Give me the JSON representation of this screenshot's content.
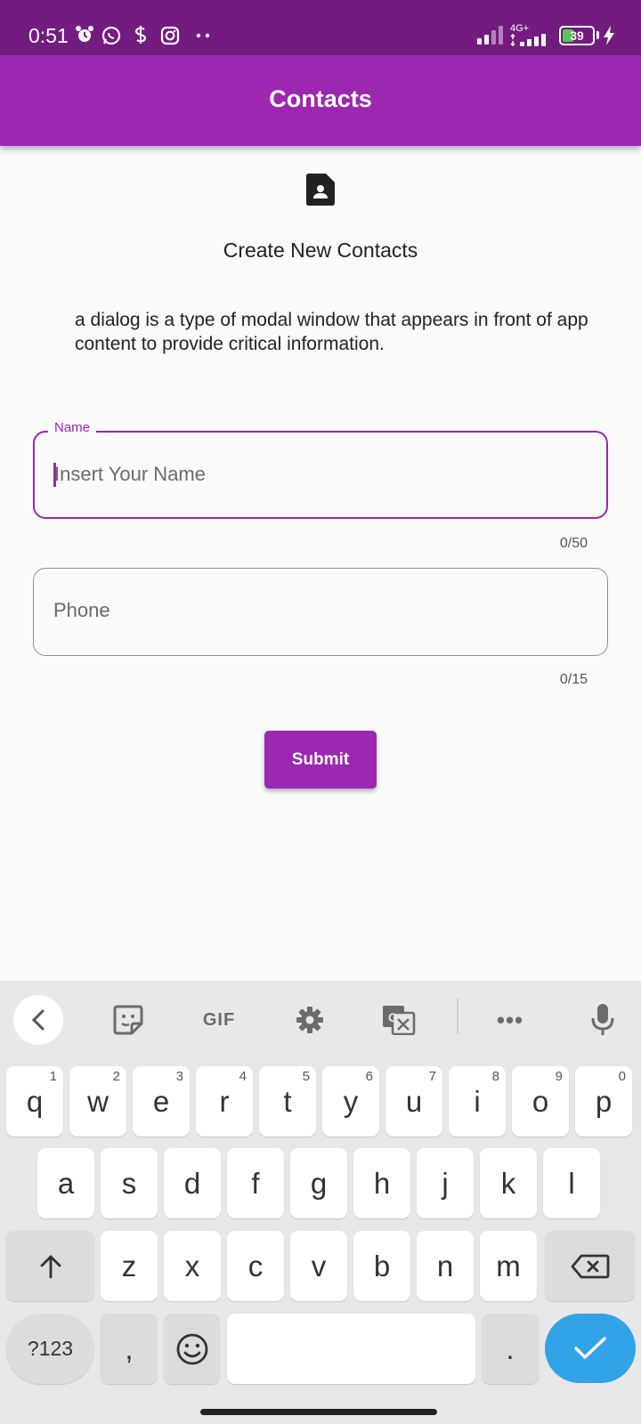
{
  "status_bar": {
    "time": "0:51",
    "network": "4G+",
    "battery": "39",
    "battery_level": 0.39,
    "icons": [
      "alarm-icon",
      "whatsapp-icon",
      "cash-app-icon",
      "instagram-icon",
      "more-dots-icon",
      "wifi-signal-icon",
      "cell-signal-icon",
      "battery-icon",
      "charging-icon"
    ]
  },
  "app_bar": {
    "title": "Contacts"
  },
  "content": {
    "heading": "Create New Contacts",
    "description": "a dialog is a type of modal window that appears in front of app content to provide critical information."
  },
  "form": {
    "name": {
      "label": "Name",
      "placeholder": "Insert Your Name",
      "value": "",
      "counter": "0/50"
    },
    "phone": {
      "placeholder": "Phone",
      "value": "",
      "counter": "0/15"
    },
    "submit_label": "Submit"
  },
  "keyboard": {
    "toolbar": {
      "gif_label": "GIF",
      "more_label": "•••"
    },
    "row1": [
      {
        "k": "q",
        "h": "1"
      },
      {
        "k": "w",
        "h": "2"
      },
      {
        "k": "e",
        "h": "3"
      },
      {
        "k": "r",
        "h": "4"
      },
      {
        "k": "t",
        "h": "5"
      },
      {
        "k": "y",
        "h": "6"
      },
      {
        "k": "u",
        "h": "7"
      },
      {
        "k": "i",
        "h": "8"
      },
      {
        "k": "o",
        "h": "9"
      },
      {
        "k": "p",
        "h": "0"
      }
    ],
    "row2": [
      "a",
      "s",
      "d",
      "f",
      "g",
      "h",
      "j",
      "k",
      "l"
    ],
    "row3": [
      "z",
      "x",
      "c",
      "v",
      "b",
      "n",
      "m"
    ],
    "symbols_label": "?123",
    "comma_label": ",",
    "period_label": ".",
    "accent_color": "#32a3e6"
  },
  "theme": {
    "primary": "#9c27b0",
    "status_bar": "#741b80"
  }
}
